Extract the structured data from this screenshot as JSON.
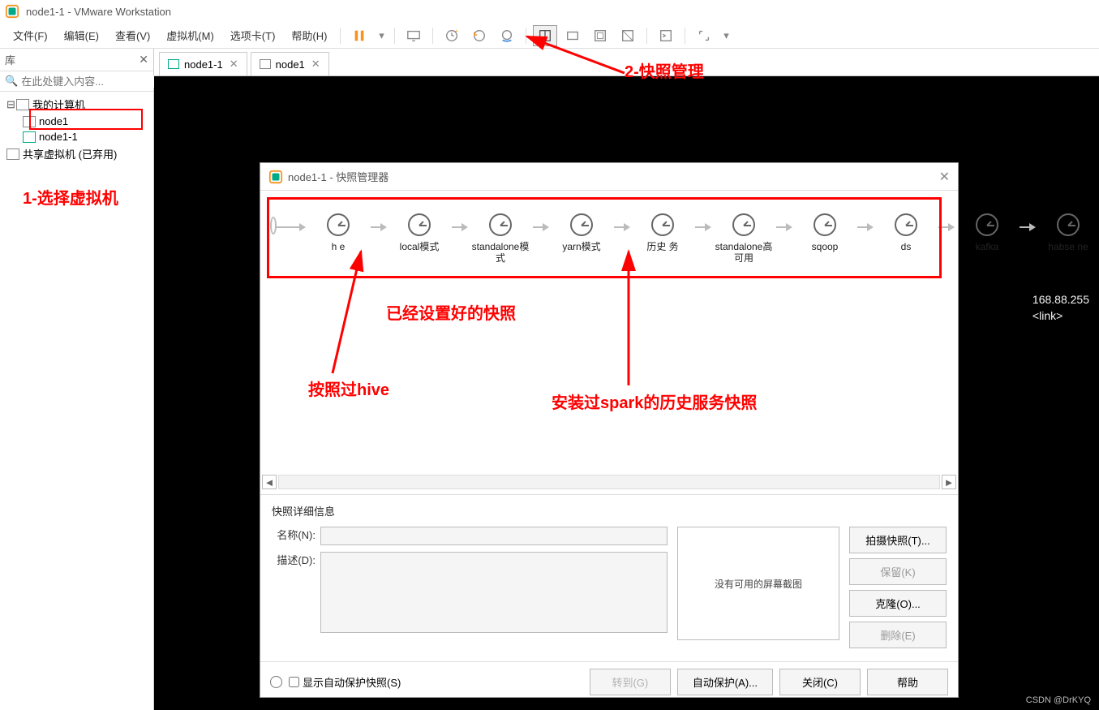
{
  "titlebar": {
    "title": "node1-1 - VMware Workstation"
  },
  "menu": {
    "file": "文件(F)",
    "edit": "编辑(E)",
    "view": "查看(V)",
    "vm": "虚拟机(M)",
    "tabs": "选项卡(T)",
    "help": "帮助(H)"
  },
  "sidebar": {
    "label": "库",
    "search_placeholder": "在此处键入内容...",
    "root": "我的计算机",
    "node1": "node1",
    "node2": "node1-1",
    "shared": "共享虚拟机 (已弃用)"
  },
  "tabs": {
    "tab1": "node1-1",
    "tab2": "node1"
  },
  "vm_text": {
    "line1": "168.88.255",
    "line2": "<link>"
  },
  "dialog": {
    "title": "node1-1 - 快照管理器",
    "timeline": [
      {
        "label": "h  e"
      },
      {
        "label": "local模式"
      },
      {
        "label": "standalone模式"
      },
      {
        "label": "yarn模式"
      },
      {
        "label": "历史  务"
      },
      {
        "label": "standalone高可用"
      },
      {
        "label": "sqoop"
      },
      {
        "label": "ds"
      },
      {
        "label": "kafka"
      },
      {
        "label": "habse ne"
      }
    ],
    "details_title": "快照详细信息",
    "name_label": "名称(N):",
    "desc_label": "描述(D):",
    "preview_text": "没有可用的屏幕截图",
    "btn_take": "拍摄快照(T)...",
    "btn_keep": "保留(K)",
    "btn_clone": "克隆(O)...",
    "btn_delete": "删除(E)",
    "auto_protect_label": "显示自动保护快照(S)",
    "btn_goto": "转到(G)",
    "btn_auto": "自动保护(A)...",
    "btn_close": "关闭(C)",
    "btn_help": "帮助"
  },
  "annotations": {
    "a1": "1-选择虚拟机",
    "a2": "2-快照管理",
    "a3": "已经设置好的快照",
    "a4": "按照过hive",
    "a5": "安装过spark的历史服务快照"
  },
  "watermark": "CSDN @DrKYQ"
}
